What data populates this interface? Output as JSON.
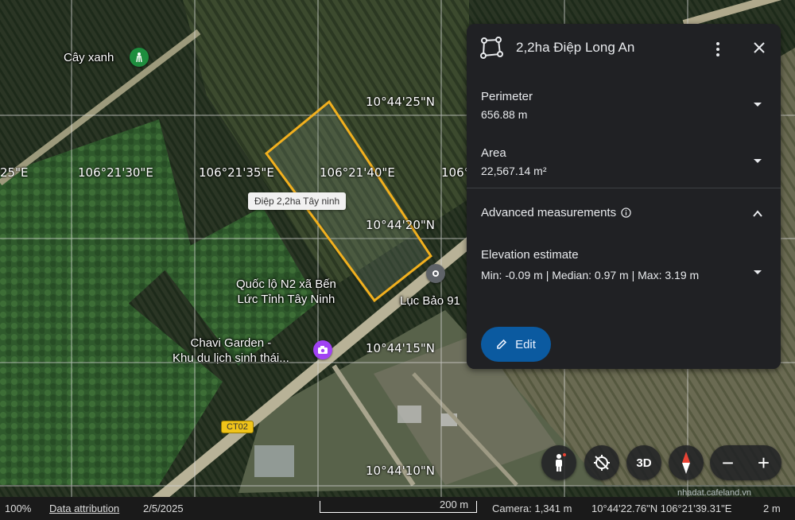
{
  "grid": {
    "longitudes": [
      "25\"E",
      "106°21'30\"E",
      "106°21'35\"E",
      "106°21'40\"E",
      "106°2"
    ],
    "latitudes": [
      "10°44'25\"N",
      "10°44'20\"N",
      "10°44'15\"N",
      "10°44'10\"N"
    ]
  },
  "places": {
    "cay_xanh": "Cây xanh",
    "quoc_lo_line1": "Quốc lộ N2 xã Bến",
    "quoc_lo_line2": "Lức Tỉnh Tây Ninh",
    "chavi_line1": "Chavi Garden -",
    "chavi_line2": "Khu du lịch sinh thái...",
    "luc_bao": "Lục Bảo 91"
  },
  "polygon_tooltip": "Điệp 2,2ha Tây ninh",
  "road_badge": "CT02",
  "panel": {
    "title": "2,2ha Điệp Long An",
    "perimeter_label": "Perimeter",
    "perimeter_value": "656.88 m",
    "area_label": "Area",
    "area_value": "22,567.14 m²",
    "advanced_label": "Advanced measurements",
    "elevation_label": "Elevation estimate",
    "elevation_value": "Min: -0.09 m | Median: 0.97 m | Max: 3.19 m",
    "edit_label": "Edit"
  },
  "controls": {
    "threed_label": "3D",
    "zoom_out": "−",
    "zoom_in": "+"
  },
  "status": {
    "zoom": "100%",
    "attribution": "Data attribution",
    "date": "2/5/2025",
    "scale": "200 m",
    "camera": "Camera: 1,341 m",
    "coords": "10°44'22.76\"N 106°21'39.31\"E",
    "elevation": "2 m"
  },
  "watermark": "nhadat.cafeland.vn",
  "colors": {
    "polygon_stroke": "#f2b01e",
    "edit_button": "#0b5aa0",
    "panel_bg": "#202124"
  }
}
